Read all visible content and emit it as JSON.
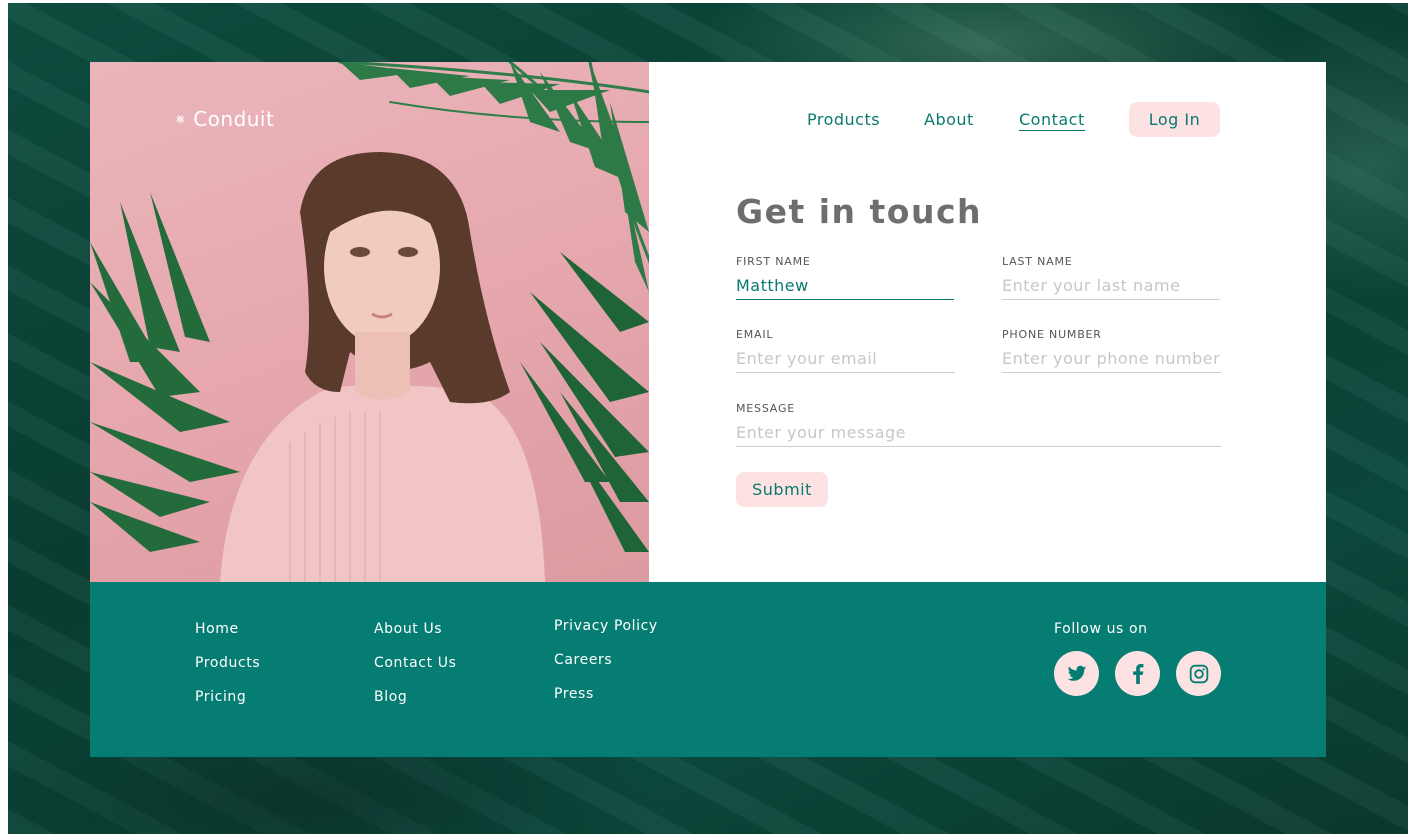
{
  "brand": {
    "name": "Conduit",
    "mark": "⨳"
  },
  "nav": {
    "items": [
      {
        "label": "Products",
        "active": false
      },
      {
        "label": "About",
        "active": false
      },
      {
        "label": "Contact",
        "active": true
      }
    ],
    "login_label": "Log In"
  },
  "form": {
    "title": "Get in touch",
    "first_name": {
      "label": "FIRST NAME",
      "value": "Matthew",
      "placeholder": ""
    },
    "last_name": {
      "label": "LAST NAME",
      "value": "",
      "placeholder": "Enter your last name"
    },
    "email": {
      "label": "EMAIL",
      "value": "",
      "placeholder": "Enter your email"
    },
    "phone": {
      "label": "PHONE NUMBER",
      "value": "",
      "placeholder": "Enter your phone number"
    },
    "message": {
      "label": "MESSAGE",
      "value": "",
      "placeholder": "Enter your message"
    },
    "submit_label": "Submit"
  },
  "footer": {
    "col1": [
      "Home",
      "Products",
      "Pricing"
    ],
    "col2": [
      "About Us",
      "Contact Us",
      "Blog"
    ],
    "col3": [
      "Privacy Policy",
      "Careers",
      "Press"
    ],
    "follow_label": "Follow us on",
    "social": [
      "twitter-icon",
      "facebook-icon",
      "instagram-icon"
    ]
  },
  "colors": {
    "accent": "#0a7a6f",
    "footer_bg": "#067d73",
    "button_bg": "#fde2e3",
    "photo_bg": "#e6a7ae",
    "page_bg": "#0c4a3d"
  }
}
